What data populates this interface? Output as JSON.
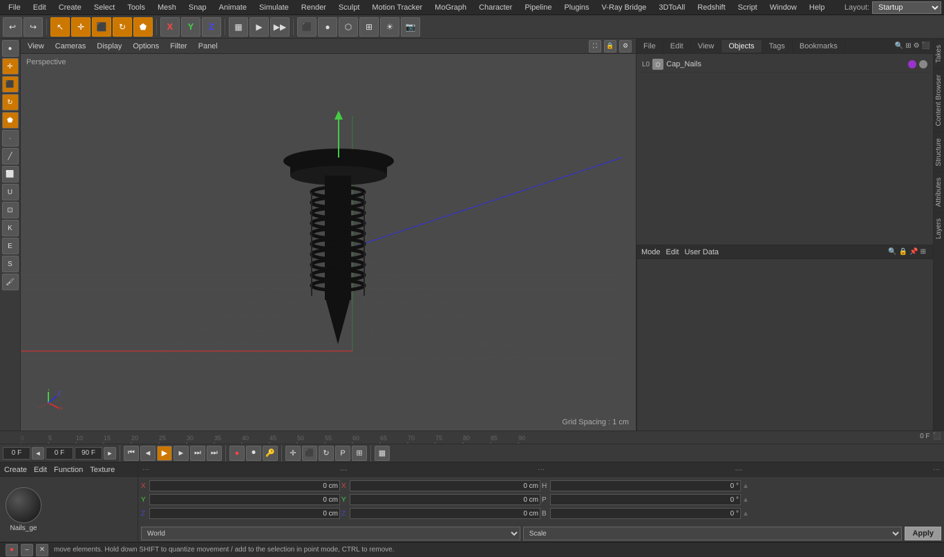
{
  "app": {
    "title": "Cinema 4D"
  },
  "menu": {
    "items": [
      "File",
      "Edit",
      "Create",
      "Select",
      "Tools",
      "Mesh",
      "Snap",
      "Animate",
      "Simulate",
      "Render",
      "Sculpt",
      "Motion Tracker",
      "MoGraph",
      "Character",
      "Pipeline",
      "Plugins",
      "V-Ray Bridge",
      "3DToAll",
      "Redshift",
      "Script",
      "Window",
      "Help"
    ],
    "layout_label": "Layout:",
    "layout_value": "Startup"
  },
  "toolbar": {
    "undo_label": "↩",
    "redo_label": "↪",
    "move_icon": "✛",
    "scale_icon": "⬛",
    "rotate_icon": "↻",
    "tools_icon": "⬟",
    "axis_x": "X",
    "axis_y": "Y",
    "axis_z": "Z",
    "lock_icon": "🔒",
    "cam_icon": "📷"
  },
  "viewport": {
    "label": "Perspective",
    "grid_spacing": "Grid Spacing : 1 cm",
    "menu_items": [
      "View",
      "Cameras",
      "Display",
      "Options",
      "Filter",
      "Panel"
    ]
  },
  "object_manager": {
    "panel_tabs": [
      "File",
      "Edit",
      "View",
      "Objects",
      "Tags",
      "Bookmarks"
    ],
    "objects": [
      {
        "name": "Cap_Nails",
        "level": "L0",
        "dot_color": "purple"
      }
    ]
  },
  "vtabs": [
    "Takes",
    "Content Browser",
    "Structure",
    "Attributes",
    "Layers"
  ],
  "timeline": {
    "frame_start": "0",
    "frame_end": "90",
    "current_frame": "0 F",
    "marks": [
      0,
      5,
      10,
      15,
      20,
      25,
      30,
      35,
      40,
      45,
      50,
      55,
      60,
      65,
      70,
      75,
      80,
      85,
      90
    ]
  },
  "transport": {
    "field_current": "0 F",
    "field_start": "0 F",
    "field_end": "90 F",
    "field_step": "90 F",
    "frame_indicator": "0 F"
  },
  "material": {
    "menu_items": [
      "Create",
      "Edit",
      "Function",
      "Texture"
    ],
    "items": [
      {
        "name": "Nails_ge",
        "type": "ball"
      }
    ]
  },
  "coordinates": {
    "header_items": [
      "---",
      "---",
      "---"
    ],
    "rows": [
      {
        "label": "X",
        "pos": "0 cm",
        "pos2": "0 cm",
        "w": "H",
        "w_val": "0 °"
      },
      {
        "label": "Y",
        "pos": "0 cm",
        "pos2": "0 cm",
        "w2": "P",
        "w2_val": "0 °"
      },
      {
        "label": "Z",
        "pos": "0 cm",
        "pos2": "0 cm",
        "w3": "B",
        "w3_val": "0 °"
      }
    ],
    "world_label": "World",
    "scale_label": "Scale",
    "apply_label": "Apply"
  },
  "attributes": {
    "panel_tabs": [
      "Mode",
      "Edit",
      "User Data"
    ],
    "panel_icons": [
      "search",
      "lock",
      "pin",
      "grid"
    ]
  },
  "status_bar": {
    "text": "move elements. Hold down SHIFT to quantize movement / add to the selection in point mode, CTRL to remove.",
    "icons": [
      "record",
      "x-icon",
      "close-icon"
    ]
  }
}
